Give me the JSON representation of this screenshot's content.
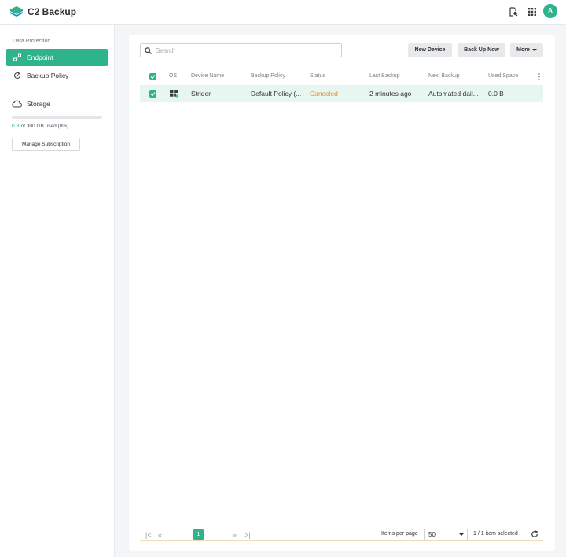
{
  "app": {
    "title": "C2 Backup",
    "avatar_initial": "A"
  },
  "topbar": {
    "icons": [
      "file-search-icon",
      "apps-grid-icon"
    ]
  },
  "sidebar": {
    "section_label": "Data Protection",
    "items": [
      {
        "label": "Endpoint",
        "icon": "endpoint-icon",
        "active": true
      },
      {
        "label": "Backup Policy",
        "icon": "backup-policy-icon",
        "active": false
      }
    ],
    "storage": {
      "label": "Storage",
      "used": "0 B",
      "usage_rest": " of 300 GB used (0%)",
      "usage_fraction": 0,
      "manage_label": "Manage Subscription"
    }
  },
  "toolbar": {
    "search_placeholder": "Search",
    "new_device_label": "New Device",
    "back_up_now_label": "Back Up Now",
    "more_label": "More"
  },
  "table": {
    "columns": [
      "OS",
      "Device Name",
      "Backup Policy",
      "Status",
      "Last Backup",
      "Next Backup",
      "Used Space"
    ],
    "rows": [
      {
        "selected": true,
        "os": "windows-icon",
        "device_name": "Strider",
        "backup_policy": "Default Policy (...",
        "status": "Canceled",
        "last_backup": "2 minutes ago",
        "next_backup": "Automated dail...",
        "used_space": "0.0 B"
      }
    ]
  },
  "footer": {
    "current_page": "1",
    "items_per_page_label": "Items per page",
    "items_per_page_value": "50",
    "selection_summary": "1 / 1 item selected"
  },
  "colors": {
    "accent": "#2fb38a",
    "status_canceled": "#ef8a2b"
  }
}
